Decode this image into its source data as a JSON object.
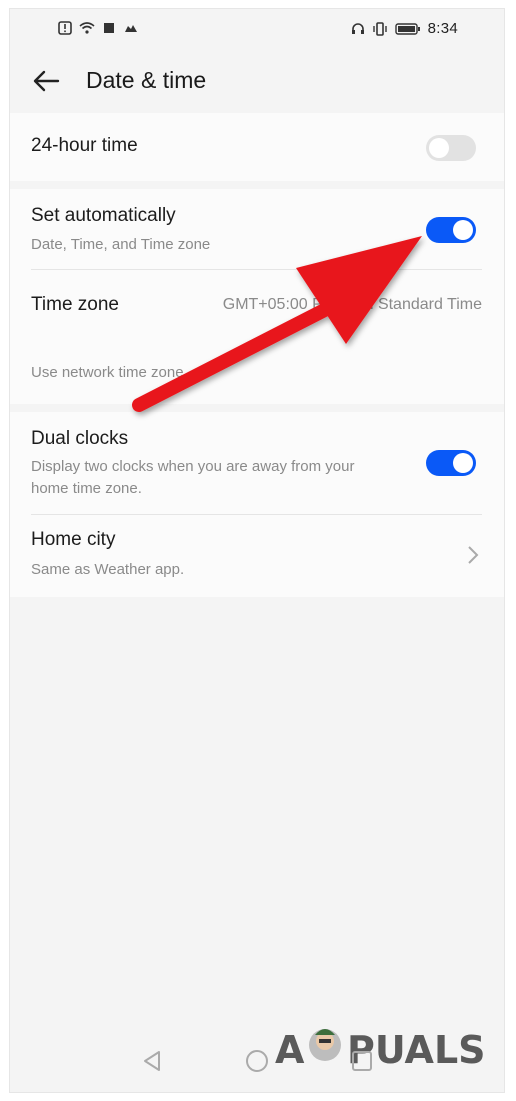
{
  "status_bar": {
    "time": "8:34",
    "left_icons": [
      "alert-icon",
      "wifi-icon",
      "notification-icon",
      "cloud-icon"
    ],
    "right_icons": [
      "headset-icon",
      "vibrate-icon",
      "battery-icon"
    ]
  },
  "header": {
    "title": "Date & time",
    "back_icon": "back-arrow-icon"
  },
  "settings": {
    "hour24": {
      "title": "24-hour time",
      "enabled": false
    },
    "set_auto": {
      "title": "Set automatically",
      "subtitle": "Date, Time, and Time zone",
      "enabled": true
    },
    "time_zone": {
      "title": "Time zone",
      "value": "GMT+05:00 Pakistan Standard Time",
      "subtitle": "Use network time zone"
    },
    "dual_clocks": {
      "title": "Dual clocks",
      "subtitle": "Display two clocks when you are away from your home time zone.",
      "enabled": true
    },
    "home_city": {
      "title": "Home city",
      "subtitle": "Same as Weather app."
    }
  },
  "nav_bar": {
    "icons": [
      "back-triangle-icon",
      "home-circle-icon",
      "recents-square-icon"
    ]
  },
  "watermark": {
    "text": "APPUALS"
  },
  "colors": {
    "accent": "#0a59f7",
    "annotation": "#e8191c",
    "background": "#f4f4f4"
  }
}
